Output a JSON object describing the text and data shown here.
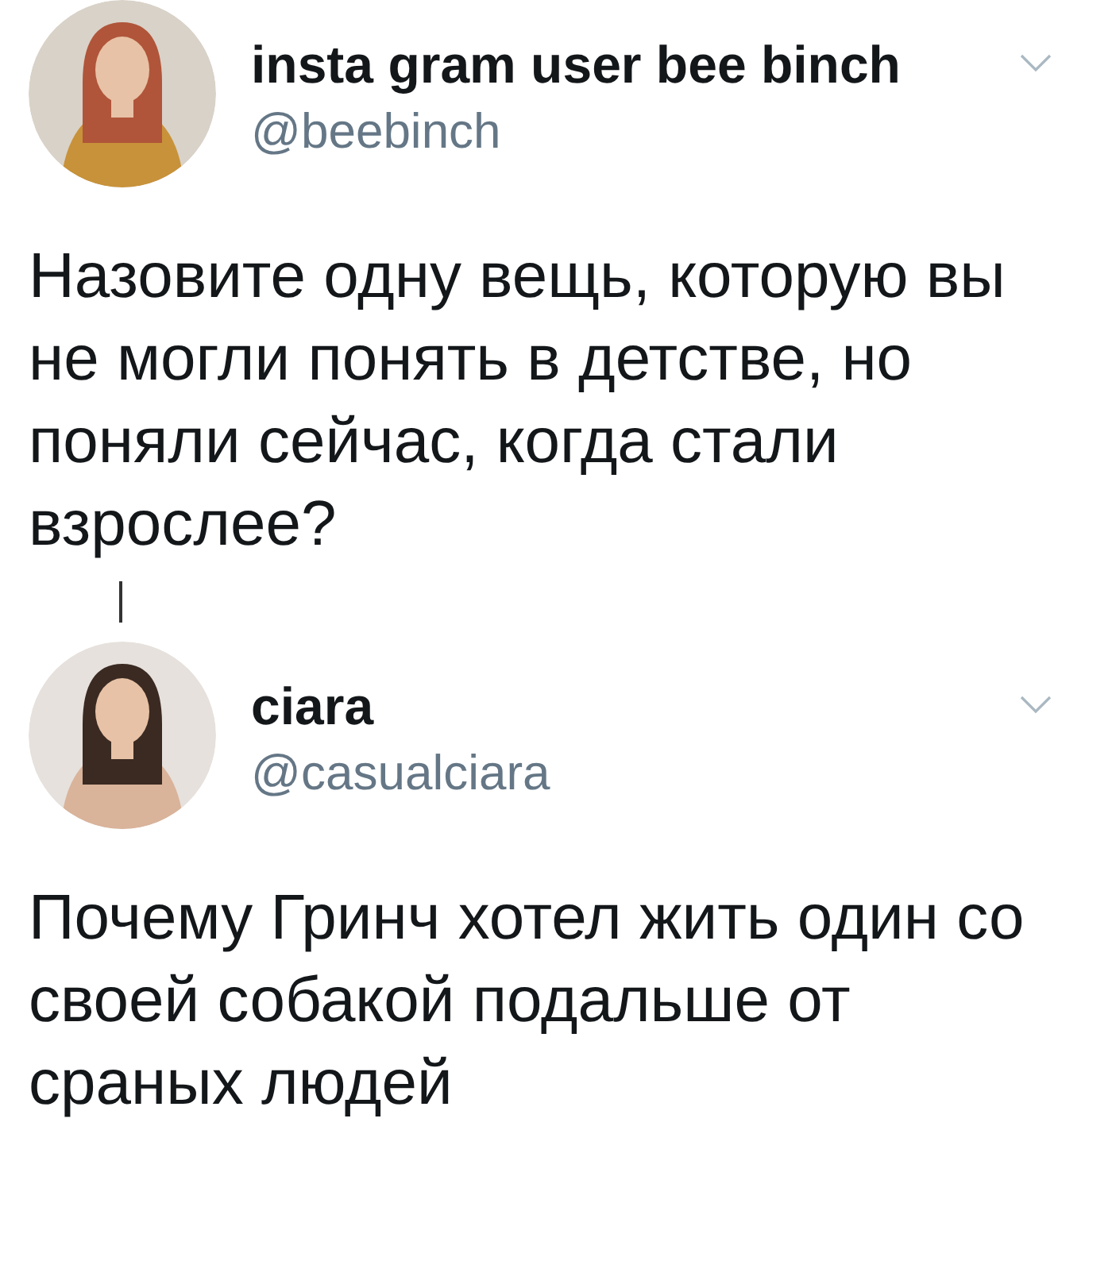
{
  "tweets": [
    {
      "name": "insta gram user bee binch",
      "handle": "@beebinch",
      "text": "Назовите одну вещь, которую вы не могли понять в детстве, но поняли сейчас, когда стали взрослее?",
      "thread_line": true
    },
    {
      "name": "ciara",
      "handle": "@casualciara",
      "text": "Почему Гринч хотел жить один со своей собакой подальше от сраных людей",
      "thread_line": false
    }
  ]
}
